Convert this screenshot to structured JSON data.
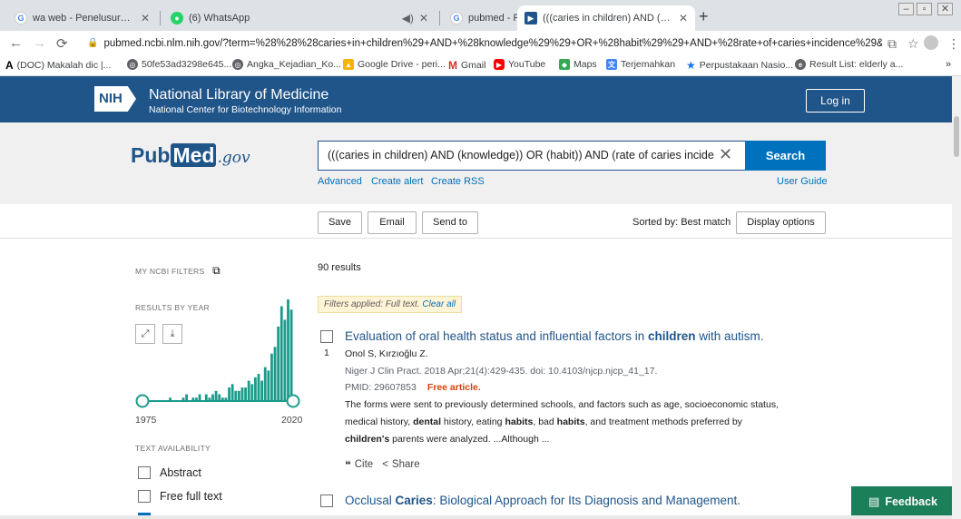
{
  "browser": {
    "tabs": [
      {
        "favicon": "G",
        "title": "wa web - Penelusuran Google",
        "color": "#4285f4"
      },
      {
        "favicon": "●",
        "title": "(6) WhatsApp",
        "color": "#25d366"
      },
      {
        "favicon": "G",
        "title": "pubmed - Penelusuran Google",
        "color": "#4285f4"
      },
      {
        "favicon": "▶",
        "title": "(((caries in children) AND (knowle",
        "color": "#20558a"
      }
    ],
    "url": "pubmed.ncbi.nlm.nih.gov/?term=%28%28%28caries+in+children%29+AND+%28knowledge%29%29+OR+%28habit%29%29+AND+%28rate+of+caries+incidence%29&filt...",
    "bookmarks": [
      "(DOC) Makalah dic |...",
      "50fe53ad3298e645...",
      "Angka_Kejadian_Ko...",
      "Google Drive - peri...",
      "Gmail",
      "YouTube",
      "Maps",
      "Terjemahkan",
      "Perpustakaan Nasio...",
      "Result List: elderly a..."
    ]
  },
  "header": {
    "logo": "NIH",
    "title": "National Library of Medicine",
    "subtitle": "National Center for Biotechnology Information",
    "login": "Log in"
  },
  "search": {
    "logo_pub": "Pub",
    "logo_med": "Med",
    "logo_gov": ".gov",
    "query": "(((caries in children) AND (knowledge)) OR (habit)) AND (rate of caries incide",
    "button": "Search",
    "links": [
      "Advanced",
      "Create alert",
      "Create RSS"
    ],
    "user_guide": "User Guide"
  },
  "actions": {
    "save": "Save",
    "email": "Email",
    "send_to": "Send to",
    "sorted": "Sorted by: Best match",
    "display": "Display options"
  },
  "sidebar": {
    "my_filters": "MY NCBI FILTERS",
    "results_by_year": "RESULTS BY YEAR",
    "year_start": "1975",
    "year_end": "2020",
    "text_availability": "TEXT AVAILABILITY",
    "options": [
      "Abstract",
      "Free full text"
    ]
  },
  "chart_data": {
    "type": "bar",
    "year_start": 1975,
    "year_end": 2020,
    "values": [
      0,
      0,
      0,
      0,
      0,
      0,
      0,
      0,
      1,
      0,
      0,
      0,
      1,
      2,
      0,
      1,
      1,
      2,
      0,
      2,
      1,
      2,
      3,
      2,
      1,
      1,
      4,
      5,
      3,
      3,
      4,
      4,
      6,
      5,
      7,
      8,
      6,
      10,
      9,
      14,
      16,
      22,
      28,
      24,
      30,
      27
    ],
    "ymax": 30,
    "bar_color": "#1c9a8a"
  },
  "results": {
    "count": "90 results",
    "filters_label": "Filters applied: Full text.",
    "clear_all": "Clear all",
    "items": [
      {
        "num": "1",
        "title_pre": "Evaluation of oral health status and influential factors in ",
        "title_bold": "children",
        "title_post": " with autism.",
        "authors": "Onol S, Kırzıoğlu Z.",
        "citation": "Niger J Clin Pract. 2018 Apr;21(4):429-435. doi: 10.4103/njcp.njcp_41_17.",
        "pmid": "PMID: 29607853",
        "free": "Free article.",
        "snippet1": "The forms were sent to previously determined schools, and factors such as age, socioeconomic status,",
        "snippet2_a": "medical history, ",
        "snippet2_b": "dental",
        "snippet2_c": " history, eating ",
        "snippet2_d": "habits",
        "snippet2_e": ", bad ",
        "snippet2_f": "habits",
        "snippet2_g": ", and treatment methods preferred by",
        "snippet3_a": "children's",
        "snippet3_b": " parents were analyzed. ...Although ...",
        "cite": "Cite",
        "share": "Share"
      },
      {
        "title_pre": "Occlusal ",
        "title_bold": "Caries",
        "title_post": ": Biological Approach for Its Diagnosis and Management."
      }
    ]
  },
  "feedback": "Feedback"
}
